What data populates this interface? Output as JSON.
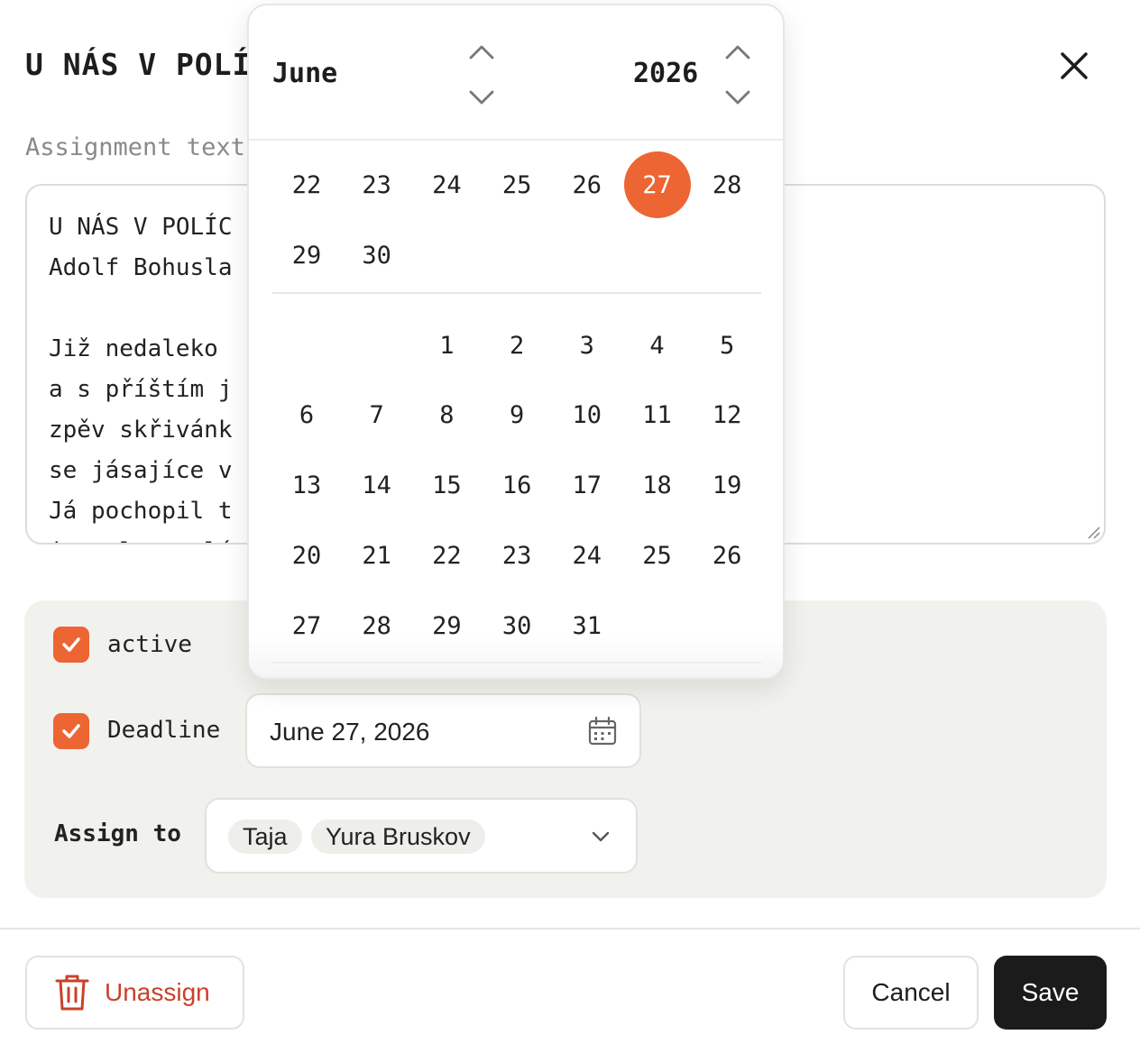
{
  "dialog": {
    "title": "U NÁS V POLÍ",
    "close_icon": "close-icon"
  },
  "assignment": {
    "label": "Assignment text",
    "lines": [
      "U NÁS V POLÍC",
      "Adolf Bohusla",
      "",
      "Již nedaleko",
      "a s příštím j",
      "zpěv skřivánk",
      "se jásajíce v",
      "Já pochopil t",
      "jsa slunce lí"
    ]
  },
  "options": {
    "active_label": "active",
    "active_checked": true,
    "deadline_label": "Deadline",
    "deadline_checked": true,
    "deadline_value": "June 27, 2026",
    "assign_label": "Assign to",
    "assignees": [
      "Taja",
      "Yura Bruskov"
    ]
  },
  "date_picker": {
    "month": "June",
    "year": "2026",
    "selected_day": "27",
    "prev_month_row1": [
      "22",
      "23",
      "24",
      "25",
      "26",
      "27",
      "28"
    ],
    "prev_month_row2": [
      "29",
      "30"
    ],
    "weeks": [
      [
        "",
        "",
        "1",
        "2",
        "3",
        "4",
        "5"
      ],
      [
        "6",
        "7",
        "8",
        "9",
        "10",
        "11",
        "12"
      ],
      [
        "13",
        "14",
        "15",
        "16",
        "17",
        "18",
        "19"
      ],
      [
        "20",
        "21",
        "22",
        "23",
        "24",
        "25",
        "26"
      ],
      [
        "27",
        "28",
        "29",
        "30",
        "31",
        "",
        ""
      ]
    ],
    "accent_color": "#ED6533"
  },
  "footer": {
    "unassign_label": "Unassign",
    "cancel_label": "Cancel",
    "save_label": "Save"
  }
}
